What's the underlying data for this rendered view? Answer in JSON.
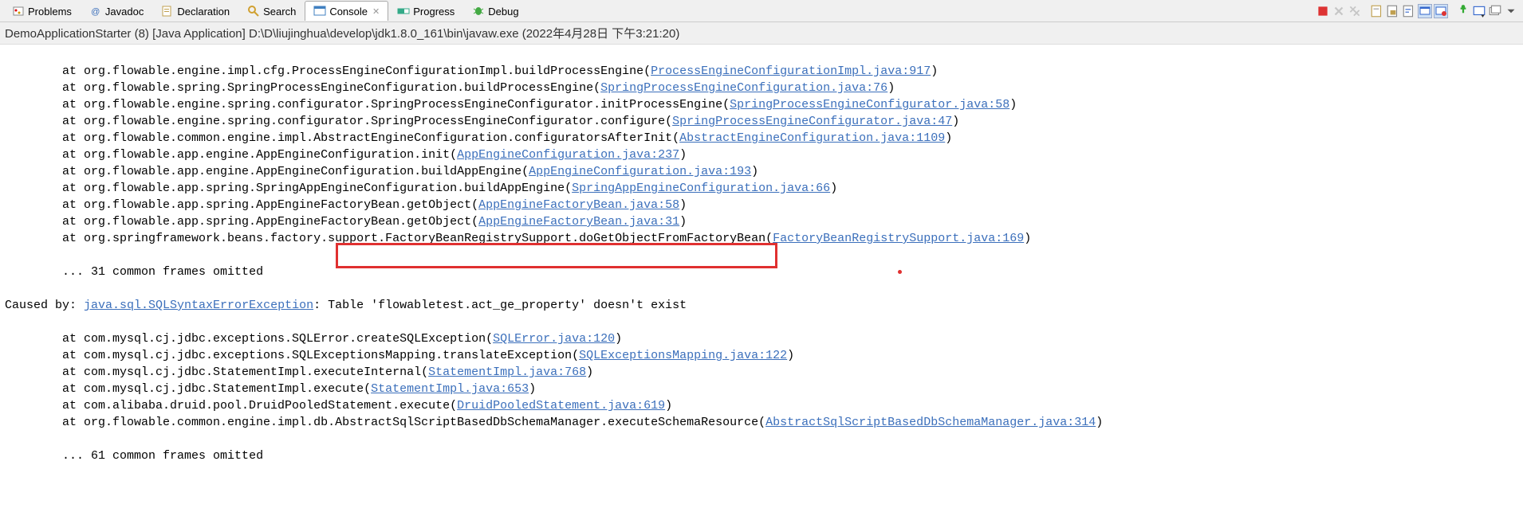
{
  "tabs": {
    "problems": "Problems",
    "javadoc": "Javadoc",
    "declaration": "Declaration",
    "search": "Search",
    "console": "Console",
    "progress": "Progress",
    "debug": "Debug"
  },
  "close_marker": "✕",
  "header": "DemoApplicationStarter (8) [Java Application] D:\\D\\liujinghua\\develop\\jdk1.8.0_161\\bin\\javaw.exe (2022年4月28日 下午3:21:20)",
  "stack_indent": "        at ",
  "omitted_indent": "        ... ",
  "caused_by_label": "Caused by: ",
  "exception_class": "java.sql.SQLSyntaxErrorException",
  "exception_msg": ": Table 'flowabletest.act_ge_property' doesn't exist",
  "lines": [
    {
      "pre": "org.flowable.engine.impl.cfg.ProcessEngineConfigurationImpl.buildProcessEngine(",
      "link": "ProcessEngineConfigurationImpl.java:917",
      "post": ")"
    },
    {
      "pre": "org.flowable.spring.SpringProcessEngineConfiguration.buildProcessEngine(",
      "link": "SpringProcessEngineConfiguration.java:76",
      "post": ")"
    },
    {
      "pre": "org.flowable.engine.spring.configurator.SpringProcessEngineConfigurator.initProcessEngine(",
      "link": "SpringProcessEngineConfigurator.java:58",
      "post": ")"
    },
    {
      "pre": "org.flowable.engine.spring.configurator.SpringProcessEngineConfigurator.configure(",
      "link": "SpringProcessEngineConfigurator.java:47",
      "post": ")"
    },
    {
      "pre": "org.flowable.common.engine.impl.AbstractEngineConfiguration.configuratorsAfterInit(",
      "link": "AbstractEngineConfiguration.java:1109",
      "post": ")"
    },
    {
      "pre": "org.flowable.app.engine.AppEngineConfiguration.init(",
      "link": "AppEngineConfiguration.java:237",
      "post": ")"
    },
    {
      "pre": "org.flowable.app.engine.AppEngineConfiguration.buildAppEngine(",
      "link": "AppEngineConfiguration.java:193",
      "post": ")"
    },
    {
      "pre": "org.flowable.app.spring.SpringAppEngineConfiguration.buildAppEngine(",
      "link": "SpringAppEngineConfiguration.java:66",
      "post": ")"
    },
    {
      "pre": "org.flowable.app.spring.AppEngineFactoryBean.getObject(",
      "link": "AppEngineFactoryBean.java:58",
      "post": ")"
    },
    {
      "pre": "org.flowable.app.spring.AppEngineFactoryBean.getObject(",
      "link": "AppEngineFactoryBean.java:31",
      "post": ")"
    },
    {
      "pre": "org.springframework.beans.factory.support.FactoryBeanRegistrySupport.doGetObjectFromFactoryBean(",
      "link": "FactoryBeanRegistrySupport.java:169",
      "post": ")"
    }
  ],
  "omitted1": "31 common frames omitted",
  "lines2": [
    {
      "pre": "com.mysql.cj.jdbc.exceptions.SQLError.createSQLException(",
      "link": "SQLError.java:120",
      "post": ")"
    },
    {
      "pre": "com.mysql.cj.jdbc.exceptions.SQLExceptionsMapping.translateException(",
      "link": "SQLExceptionsMapping.java:122",
      "post": ")"
    },
    {
      "pre": "com.mysql.cj.jdbc.StatementImpl.executeInternal(",
      "link": "StatementImpl.java:768",
      "post": ")"
    },
    {
      "pre": "com.mysql.cj.jdbc.StatementImpl.execute(",
      "link": "StatementImpl.java:653",
      "post": ")"
    },
    {
      "pre": "com.alibaba.druid.pool.DruidPooledStatement.execute(",
      "link": "DruidPooledStatement.java:619",
      "post": ")"
    },
    {
      "pre": "org.flowable.common.engine.impl.db.AbstractSqlScriptBasedDbSchemaManager.executeSchemaResource(",
      "link": "AbstractSqlScriptBasedDbSchemaManager.java:314",
      "post": ")"
    }
  ],
  "omitted2": "61 common frames omitted"
}
